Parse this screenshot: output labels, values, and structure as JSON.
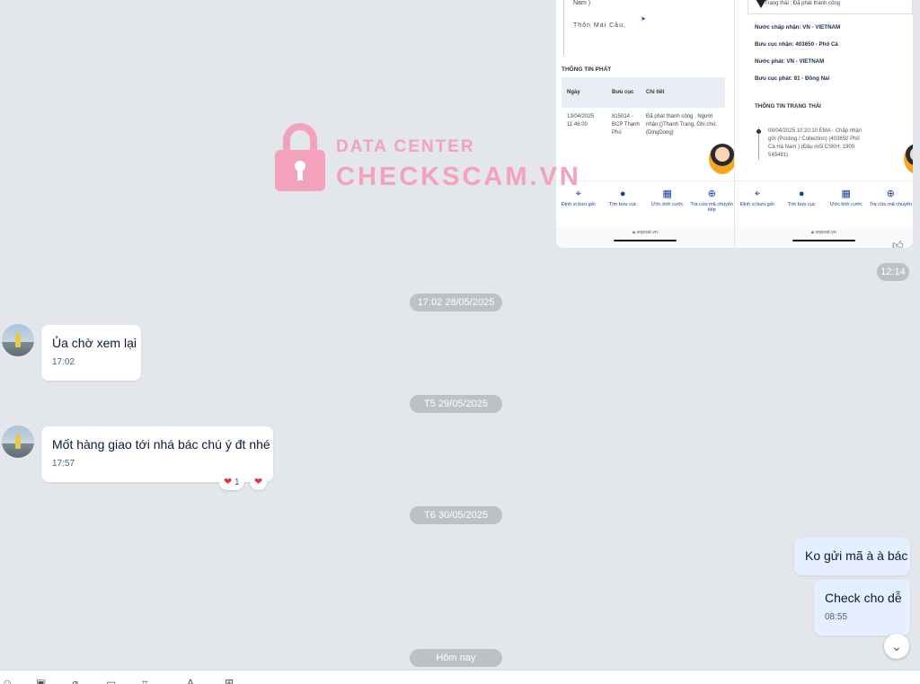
{
  "screenshot_left": {
    "address_line1": "Nam )",
    "address_line2": "Thôn    Mai    Cầu,",
    "section_title": "THÔNG TIN PHÁT",
    "table_headers": [
      "Ngày",
      "Bưu cục",
      "Chi tiết"
    ],
    "row": {
      "date": "13/04/2025 11:46:00",
      "office": "815014 - BCP Thạnh Phú",
      "detail": "Đã phát thành công . Người nhận:()Thanh Trang. Ghi chú: (DingDong)"
    },
    "nav": [
      "Định vị bưu gửi",
      "Tìm bưu cục",
      "Ước tính cước",
      "Tra cứu mã chuyển tiếp"
    ],
    "url": "vnpost.vn"
  },
  "screenshot_right": {
    "status": "Trạng thái : Đã phát thành công",
    "lines": [
      "Nước chấp nhận: VN - VIETNAM",
      "Bưu cục nhận: 403650 - Phố Cà",
      "Nước phát: VN - VIETNAM",
      "Bưu cục phát: 81 - Đồng Nai"
    ],
    "section_title": "THÔNG TIN TRẠNG THÁI",
    "timeline_entry": "08/04/2025 10:20:10 EMA - Chấp nhận gửi (Posting / Collection) (403650 Phố Cà Hà Nam ) (Đầu mối CSKH: 1900 545481)",
    "nav": [
      "Định vị bưu gửi",
      "Tìm bưu cục",
      "Ước tính cước",
      "Tra cứu mã chuyển"
    ],
    "url": "vnpost.vn"
  },
  "watermark": {
    "line1": "DATA CENTER",
    "line2": "CHECKSCAM.VN"
  },
  "image_time": "12:14",
  "date_pills": [
    "17:02 28/05/2025",
    "T5 29/05/2025",
    "T6 30/05/2025",
    "Hôm nay"
  ],
  "messages": [
    {
      "text": "Ủa chờ xem lại",
      "time": "17:02"
    },
    {
      "text": "Mốt hàng giao tới nhá bác chú ý đt nhé",
      "time": "17:57",
      "reaction_count": "1"
    },
    {
      "text": "Ko gửi mã à à bác"
    },
    {
      "text": "Check cho dễ",
      "time": "08:55"
    }
  ],
  "icons": {
    "scroll_down": "chevron-down-icon",
    "toolbar": [
      "sticker-icon",
      "image-icon",
      "attach-icon",
      "screenshot-icon",
      "crop-icon",
      "text-format-icon",
      "more-icon"
    ]
  },
  "colors": {
    "background": "#e3e6ea",
    "my_bubble": "#e5efff",
    "pill": "#bdc1c6",
    "watermark": "#f2a2ba"
  }
}
